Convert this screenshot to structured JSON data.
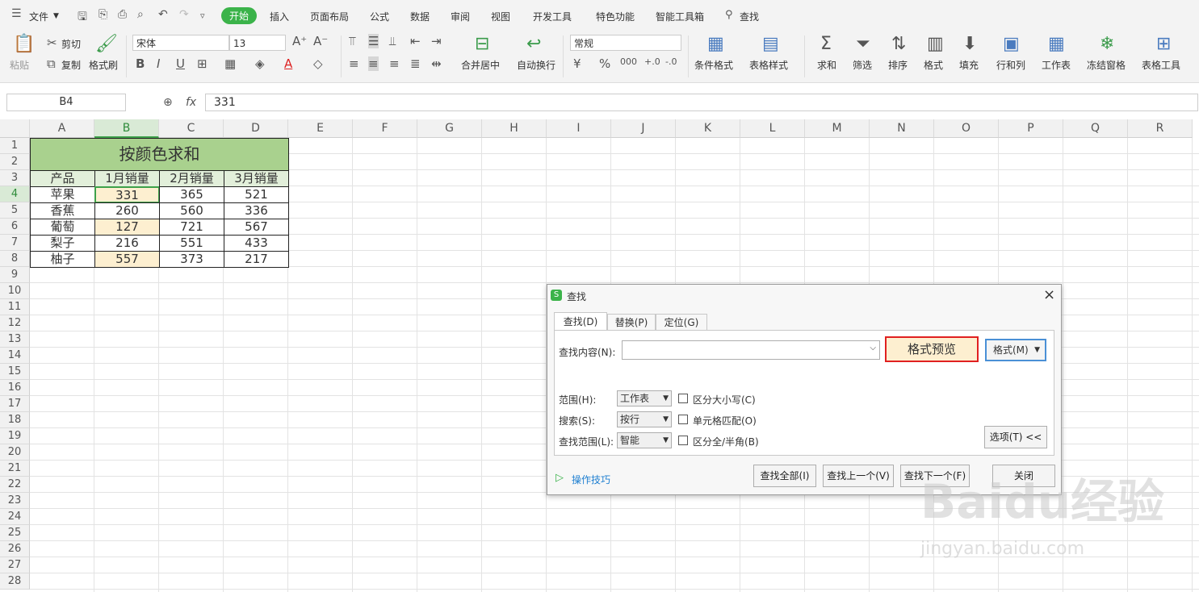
{
  "menubar": {
    "file": "文件",
    "tabs": [
      "开始",
      "插入",
      "页面布局",
      "公式",
      "数据",
      "审阅",
      "视图",
      "开发工具",
      "特色功能",
      "智能工具箱"
    ],
    "search": "查找"
  },
  "ribbon": {
    "paste": "粘贴",
    "cut": "剪切",
    "copy": "复制",
    "format_painter": "格式刷",
    "font_name": "宋体",
    "font_size": "13",
    "number_format": "常规",
    "merge_center": "合并居中",
    "wrap_text": "自动换行",
    "cond_format": "条件格式",
    "table_style": "表格样式",
    "sum": "求和",
    "filter": "筛选",
    "sort": "排序",
    "format": "格式",
    "fill": "填充",
    "row_col": "行和列",
    "worksheet": "工作表",
    "freeze": "冻结窗格",
    "table_tools": "表格工具"
  },
  "formula_bar": {
    "cell_ref": "B4",
    "fx": "fx",
    "value": "331"
  },
  "columns": [
    "A",
    "B",
    "C",
    "D",
    "E",
    "F",
    "G",
    "H",
    "I",
    "J",
    "K",
    "L",
    "M",
    "N",
    "O",
    "P",
    "Q",
    "R"
  ],
  "rows": [
    "1",
    "2",
    "3",
    "4",
    "5",
    "6",
    "7",
    "8",
    "9",
    "10",
    "11",
    "12",
    "13",
    "14",
    "15",
    "16",
    "17",
    "18",
    "19",
    "20",
    "21",
    "22",
    "23",
    "24",
    "25",
    "26",
    "27",
    "28"
  ],
  "table": {
    "title": "按颜色求和",
    "headers": [
      "产品",
      "1月销量",
      "2月销量",
      "3月销量"
    ],
    "data": [
      [
        "苹果",
        "331",
        "365",
        "521"
      ],
      [
        "香蕉",
        "260",
        "560",
        "336"
      ],
      [
        "葡萄",
        "127",
        "721",
        "567"
      ],
      [
        "梨子",
        "216",
        "551",
        "433"
      ],
      [
        "柚子",
        "557",
        "373",
        "217"
      ]
    ],
    "highlighted_rows": [
      0,
      2,
      4
    ],
    "colors": {
      "title_bg": "#a9d18e",
      "highlight_bg": "#fdefd0",
      "header_bg": "#e2efda"
    }
  },
  "dialog": {
    "title": "查找",
    "tabs": [
      "查找(D)",
      "替换(P)",
      "定位(G)"
    ],
    "find_label": "查找内容(N):",
    "find_value": "",
    "format_preview": "格式预览",
    "format_button": "格式(M)",
    "scope_label": "范围(H):",
    "scope_value": "工作表",
    "search_label": "搜索(S):",
    "search_value": "按行",
    "lookin_label": "查找范围(L):",
    "lookin_value": "智能",
    "match_case": "区分大小写(C)",
    "match_cell": "单元格匹配(O)",
    "match_width": "区分全/半角(B)",
    "options_button": "选项(T) <<",
    "tips": "操作技巧",
    "find_all": "查找全部(I)",
    "find_prev": "查找上一个(V)",
    "find_next": "查找下一个(F)",
    "close": "关闭"
  },
  "watermark": {
    "main": "Baidu经验",
    "sub": "jingyan.baidu.com"
  }
}
